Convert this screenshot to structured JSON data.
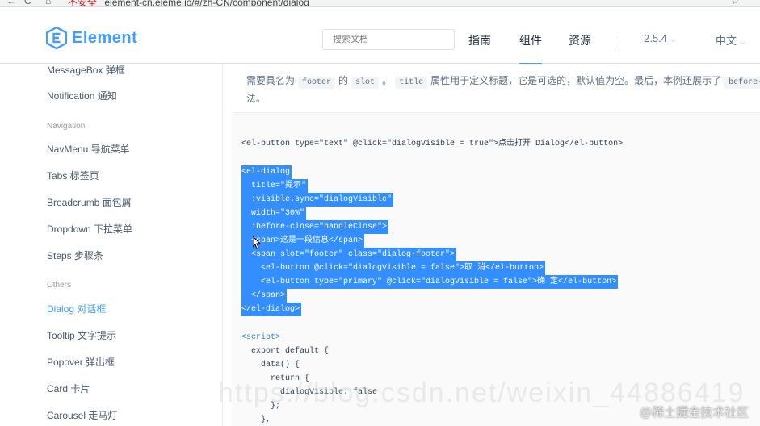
{
  "browser": {
    "back": "←",
    "reload": "C",
    "home": "⌂",
    "security": "不安全",
    "url": "element-cn.eleme.io/#/zh-CN/component/dialog"
  },
  "header": {
    "logo_text": "Element",
    "search_placeholder": "搜索文档",
    "nav": [
      "指南",
      "组件",
      "资源"
    ],
    "version": "2.5.4",
    "language": "中文",
    "accent_color": "#409eff"
  },
  "sidebar": {
    "items_top": [
      "MessageBox 弹框",
      "Notification 通知"
    ],
    "group_navigation": "Navigation",
    "items_navigation": [
      "NavMenu 导航菜单",
      "Tabs 标签页",
      "Breadcrumb 面包屑",
      "Dropdown 下拉菜单",
      "Steps 步骤条"
    ],
    "group_others": "Others",
    "items_others": [
      "Dialog 对话框",
      "Tooltip 文字提示",
      "Popover 弹出框",
      "Card 卡片",
      "Carousel 走马灯"
    ]
  },
  "description": {
    "line2_pre": "需要具名为",
    "code_footer": "footer",
    "line2_mid": "的",
    "code_slot": "slot",
    "line2_mid2": "。",
    "code_title": "title",
    "line2_post": "属性用于定义标题，它是可选的，默认值为空。最后，本例还展示了",
    "code_before_close": "before-close",
    "line3": "法。"
  },
  "code": {
    "button_line": "<el-button type=\"text\" @click=\"dialogVisible = true\">点击打开 Dialog</el-button>",
    "dialog_lines": [
      "<el-dialog",
      "  title=\"提示\"",
      "  :visible.sync=\"dialogVisible\"",
      "  width=\"30%\"",
      "  :before-close=\"handleClose\">",
      "  <span>这是一段信息</span>",
      "  <span slot=\"footer\" class=\"dialog-footer\">",
      "    <el-button @click=\"dialogVisible = false\">取 消</el-button>",
      "    <el-button type=\"primary\" @click=\"dialogVisible = false\">确 定</el-button>",
      "  </span>",
      "</el-dialog>"
    ],
    "script_lines": [
      "<script>",
      "  export default {",
      "    data() {",
      "      return {",
      "        dialogVisible: false",
      "      };",
      "    },"
    ]
  },
  "watermark": "@稀土掘金技术社区",
  "faint_watermark": "https://blog.csdn.net/weixin_44886419"
}
